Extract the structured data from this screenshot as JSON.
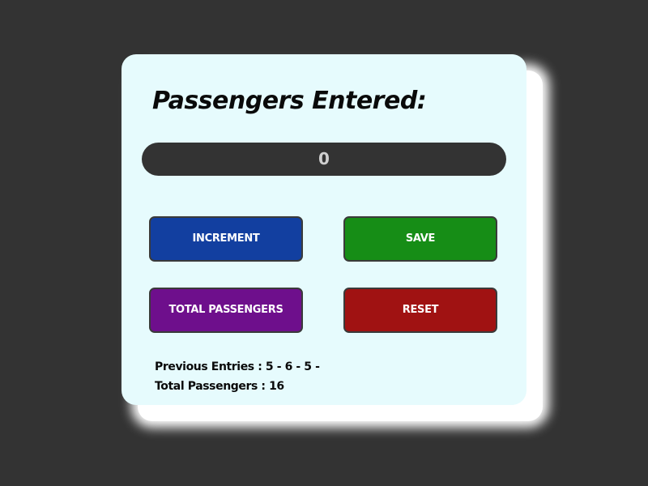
{
  "counter": {
    "title": "Passengers Entered:",
    "value": "0"
  },
  "buttons": {
    "increment": "INCREMENT",
    "save": "SAVE",
    "total": "TOTAL PASSENGERS",
    "reset": "RESET"
  },
  "history": {
    "previous_entries": "Previous Entries : 5 - 6 - 5 -",
    "total_passengers": "Total Passengers : 16"
  },
  "colors": {
    "background": "#333333",
    "card": "#e6fbfd",
    "increment": "#123fa0",
    "save": "#168d16",
    "total": "#6e0f8c",
    "reset": "#a01212"
  }
}
